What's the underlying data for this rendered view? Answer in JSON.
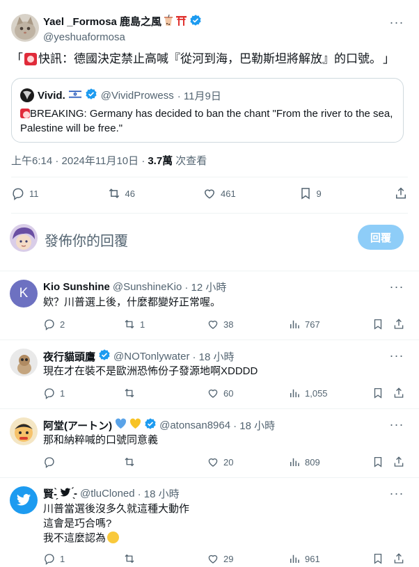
{
  "main": {
    "author": {
      "name": "Yael _Formosa 鹿島之風",
      "handle": "@yeshuaformosa"
    },
    "text": "快訊：德國決定禁止高喊『從河到海，巴勒斯坦將解放』的口號。",
    "text_open": "「",
    "text_close": "」",
    "quote": {
      "name": "Vivid.",
      "handle": "@VividProwess",
      "date": "· 11月9日",
      "text": "BREAKING: Germany has decided to ban the chant \"From the river to the sea, Palestine will be free.\""
    },
    "timestamp": "上午6:14 · 2024年11月10日 · ",
    "views": "3.7萬",
    "views_label": " 次查看",
    "stats": {
      "replies": "11",
      "reposts": "46",
      "likes": "461",
      "bookmarks": "9"
    }
  },
  "reply_box": {
    "placeholder": "發佈你的回覆",
    "button": "回覆"
  },
  "comments": [
    {
      "name": "Kio Sunshine",
      "handle": "@SunshineKio",
      "time": "· 12 小時",
      "text": "欸？川普選上後，什麼都變好正常喔。",
      "replies": "2",
      "reposts": "1",
      "likes": "38",
      "views": "767",
      "avatar_letter": "K"
    },
    {
      "name": "夜行貓頭鷹",
      "handle": "@NOTonlywater",
      "time": "· 18 小時",
      "text": "現在才在裝不是歐洲恐怖份子發源地啊XDDDD",
      "replies": "1",
      "reposts": "",
      "likes": "60",
      "views": "1,055"
    },
    {
      "name": "阿堂(アートン)",
      "handle": "@atonsan8964",
      "time": "· 18 小時",
      "text": "那和納粹喊的口號同意義",
      "replies": "",
      "reposts": "",
      "likes": "20",
      "views": "809"
    },
    {
      "name": "賢-̗̀ ",
      "name_tail": " ̖́-",
      "handle": "@tluCloned",
      "time": "· 18 小時",
      "text1": "川普當選後沒多久就這種大動作",
      "text2": "這會是巧合嗎?",
      "text3": "我不這麼認為",
      "replies": "1",
      "reposts": "",
      "likes": "29",
      "views": "961"
    }
  ],
  "colors": {
    "accent": "#1d9bf0",
    "secondary_text": "#536471",
    "divider": "#eff3f4",
    "verified": "#1d9bf0",
    "reply_button": "#8ecdf8"
  }
}
